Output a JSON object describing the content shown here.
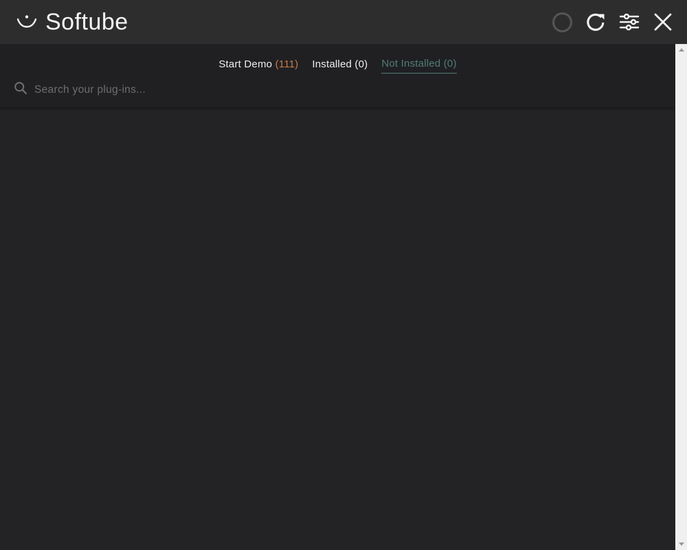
{
  "topbar": {
    "logo_text": "Softube",
    "icons": {
      "status": "status-circle-icon",
      "refresh": "refresh-icon",
      "filter": "filter-sliders-icon",
      "close": "close-icon"
    }
  },
  "tabs": [
    {
      "label": "Start Demo ",
      "count": "(111)",
      "active": false
    },
    {
      "label": "Installed ",
      "count": "(0)",
      "active": false
    },
    {
      "label": "Not Installed ",
      "count": "(0)",
      "active": true
    }
  ],
  "search": {
    "placeholder": "Search your plug-ins...",
    "value": ""
  },
  "colors": {
    "topbar_bg": "#2d2d2d",
    "header_bg": "#202023",
    "content_bg": "#232326",
    "demo_count_orange": "#c97c45",
    "active_tab_teal": "#517d74",
    "text_white": "#f0f0f0",
    "placeholder_gray": "#6e6e6e",
    "scrollbar_track": "#f0f0f0",
    "scrollbar_arrow": "#9a9a9a"
  }
}
